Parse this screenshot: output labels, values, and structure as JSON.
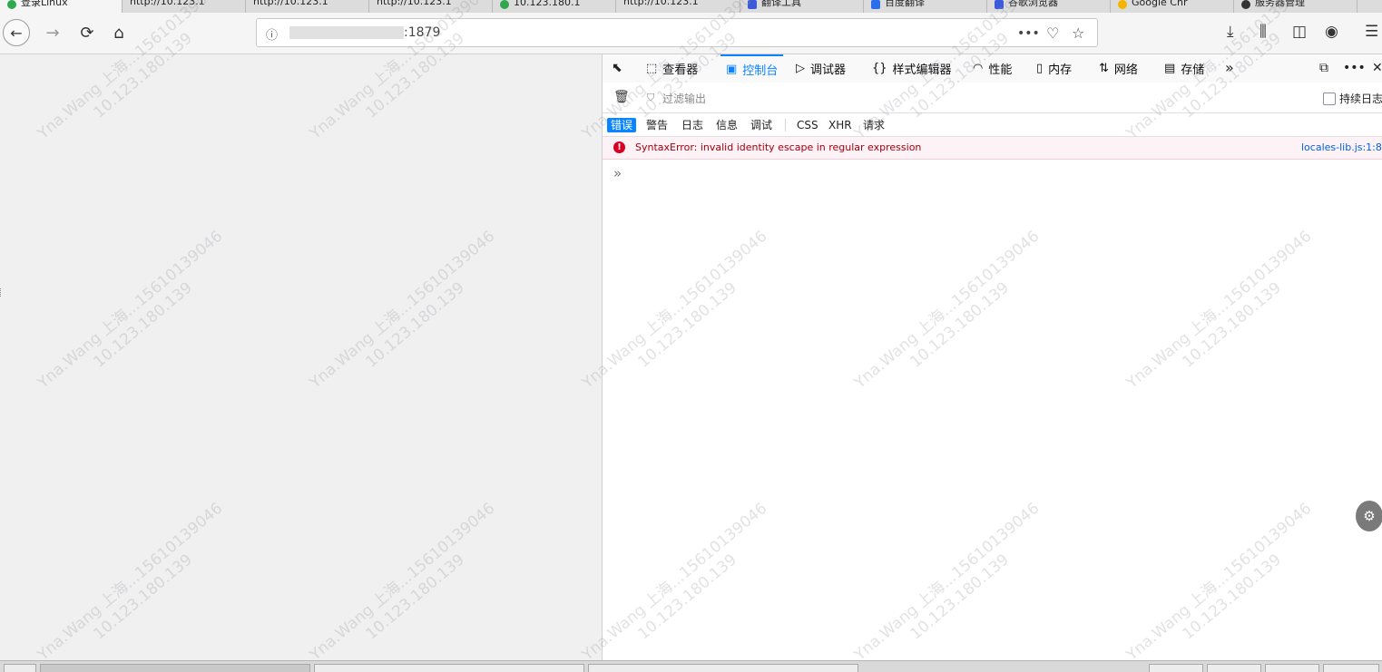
{
  "tabs": [
    {
      "label": "登录Linux",
      "favicon_color": "#2fa84f",
      "active": true
    },
    {
      "label": "http://10.123.1",
      "favicon_color": "",
      "active": false
    },
    {
      "label": "http://10.123.1",
      "favicon_color": "",
      "active": false
    },
    {
      "label": "http://10.123.1",
      "favicon_color": "",
      "active": false
    },
    {
      "label": "10.123.180.1",
      "favicon_color": "#2fa84f",
      "active": false
    },
    {
      "label": "http://10.123.1",
      "favicon_color": "",
      "active": false
    },
    {
      "label": "翻译工具",
      "favicon_color": "#3b5bdb",
      "active": false
    },
    {
      "label": "百度翻译",
      "favicon_color": "#2b6ee8",
      "active": false
    },
    {
      "label": "谷歌浏览器",
      "favicon_color": "#3b5bdb",
      "active": false
    },
    {
      "label": "Google Chr",
      "favicon_color": "#f4b400",
      "active": false
    },
    {
      "label": "服务器管理",
      "favicon_color": "#333333",
      "active": false
    }
  ],
  "nav": {
    "back_icon": "back-arrow-icon",
    "url_suffix": ":1879",
    "url_masked": true
  },
  "devtools": {
    "tabs": [
      {
        "label": "查看器",
        "icon": "inspector-icon",
        "glyph": "⬚"
      },
      {
        "label": "控制台",
        "icon": "console-icon",
        "glyph": "▣",
        "active": true
      },
      {
        "label": "调试器",
        "icon": "debugger-icon",
        "glyph": "▷"
      },
      {
        "label": "样式编辑器",
        "icon": "style-editor-icon",
        "glyph": "{}"
      },
      {
        "label": "性能",
        "icon": "performance-icon",
        "glyph": "◠"
      },
      {
        "label": "内存",
        "icon": "memory-icon",
        "glyph": "▯"
      },
      {
        "label": "网络",
        "icon": "network-icon",
        "glyph": "⇅"
      },
      {
        "label": "存储",
        "icon": "storage-icon",
        "glyph": "▤"
      }
    ],
    "filter_placeholder": "过滤输出",
    "persist_logs_label": "持续日志",
    "persist_logs_checked": false,
    "levels": [
      {
        "label": "错误",
        "active": true
      },
      {
        "label": "警告",
        "active": false
      },
      {
        "label": "日志",
        "active": false
      },
      {
        "label": "信息",
        "active": false
      },
      {
        "label": "调试",
        "active": false
      },
      {
        "label": "CSS",
        "active": false
      },
      {
        "label": "XHR",
        "active": false
      },
      {
        "label": "请求",
        "active": false
      }
    ],
    "messages": [
      {
        "level": "error",
        "text": "SyntaxError: invalid identity escape in regular expression",
        "location": "locales-lib.js:1:8"
      }
    ],
    "prompt_glyph": "»"
  },
  "watermark": {
    "line1": "Yna.Wang 上海...15610139046",
    "line2": "10.123.180.139"
  },
  "colors": {
    "accent": "#0a84ff",
    "error_bg": "#fdf2f5",
    "error_text": "#a4000f",
    "link": "#0060df"
  }
}
